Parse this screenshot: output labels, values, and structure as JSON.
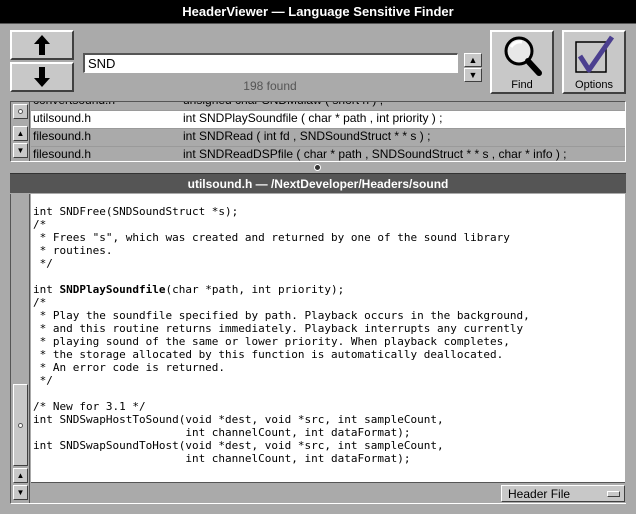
{
  "window": {
    "title": "HeaderViewer — Language Sensitive Finder"
  },
  "search": {
    "value": "SND",
    "found_text": "198 found"
  },
  "buttons": {
    "find_label": "Find",
    "options_label": "Options"
  },
  "results": [
    {
      "file": "convertsound.h",
      "decl": "unsigned char SNDMulaw ( short n ) ;"
    },
    {
      "file": "utilsound.h",
      "decl": "int SNDPlaySoundfile ( char * path , int priority ) ;"
    },
    {
      "file": "filesound.h",
      "decl": "int SNDRead ( int fd , SNDSoundStruct * * s ) ;"
    },
    {
      "file": "filesound.h",
      "decl": "int SNDReadDSPfile ( char * path , SNDSoundStruct * * s , char * info ) ;"
    }
  ],
  "path_bar": "utilsound.h — /NextDeveloper/Headers/sound",
  "code": {
    "line1": "int SNDFree(SNDSoundStruct *s);",
    "line2": "/*",
    "line3": " * Frees \"s\", which was created and returned by one of the sound library",
    "line4": " * routines.",
    "line5": " */",
    "line6": "",
    "line7_prefix": "int ",
    "line7_bold": "SNDPlaySoundfile",
    "line7_suffix": "(char *path, int priority);",
    "line8": "/*",
    "line9": " * Play the soundfile specified by path. Playback occurs in the background,",
    "line10": " * and this routine returns immediately. Playback interrupts any currently",
    "line11": " * playing sound of the same or lower priority. When playback completes,",
    "line12": " * the storage allocated by this function is automatically deallocated.",
    "line13": " * An error code is returned.",
    "line14": " */",
    "line15": "",
    "line16": "/* New for 3.1 */",
    "line17": "int SNDSwapHostToSound(void *dest, void *src, int sampleCount,",
    "line18": "                       int channelCount, int dataFormat);",
    "line19": "int SNDSwapSoundToHost(void *dest, void *src, int sampleCount,",
    "line20": "                       int channelCount, int dataFormat);"
  },
  "view_mode": "Header File"
}
